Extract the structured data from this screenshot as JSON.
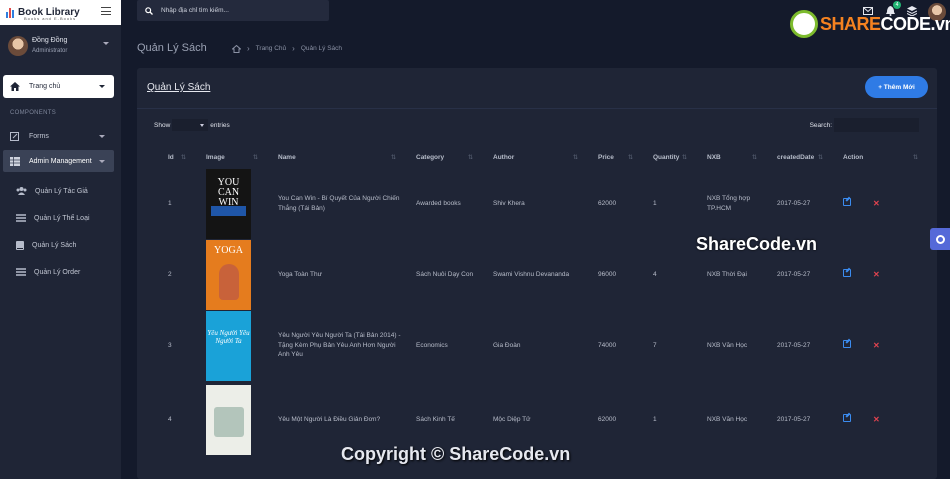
{
  "brand": {
    "title": "Book Library",
    "subtitle": "Books and E-Books"
  },
  "user": {
    "name": "Đồng Đồng",
    "role": "Administrator"
  },
  "sidebar": {
    "home_label": "Trang chủ",
    "section_label": "COMPONENTS",
    "forms_label": "Forms",
    "admin_label": "Admin Management",
    "sub_items": [
      {
        "label": "Quản Lý Tác Giả",
        "icon": "users-icon"
      },
      {
        "label": "Quản Lý Thể Loại",
        "icon": "list-icon"
      },
      {
        "label": "Quản Lý Sách",
        "icon": "book-icon"
      },
      {
        "label": "Quản Lý Order",
        "icon": "list-icon"
      }
    ]
  },
  "topbar": {
    "search_placeholder": "Nhập địa chỉ tìm kiếm...",
    "notification_count": "4",
    "watermark": {
      "share": "SHARE",
      "code": "CODE.vn"
    }
  },
  "page": {
    "title": "Quản Lý Sách",
    "breadcrumb": [
      "Trang Chủ",
      "Quản Lý Sách"
    ]
  },
  "card": {
    "title": "Quản Lý Sách",
    "add_button": "+ Thêm Mới",
    "show_label": "Show",
    "entries_label": "entries",
    "search_label": "Search:"
  },
  "table": {
    "columns": [
      "Id",
      "Image",
      "Name",
      "Category",
      "Author",
      "Price",
      "Quantity",
      "NXB",
      "createdDate",
      "Action"
    ],
    "rows": [
      {
        "id": "1",
        "cover_title": "YOU CAN WIN",
        "name": "You Can Win - Bí Quyết Của Người Chiến Thắng (Tái Bản)",
        "category": "Awarded books",
        "author": "Shiv Khera",
        "price": "62000",
        "quantity": "1",
        "nxb": "NXB Tổng hợp TP.HCM",
        "created": "2017-05-27"
      },
      {
        "id": "2",
        "cover_title": "YOGA",
        "name": "Yoga Toàn Thư",
        "category": "Sách Nuôi Dạy Con",
        "author": "Swami Vishnu Devananda",
        "price": "96000",
        "quantity": "4",
        "nxb": "NXB Thời Đại",
        "created": "2017-05-27"
      },
      {
        "id": "3",
        "cover_title": "Yêu Người Yêu Người Ta",
        "name": "Yêu Người Yêu Người Ta (Tái Bản 2014) - Tặng Kèm Phụ Bản Yêu Anh Hơn Người Anh Yêu",
        "category": "Economics",
        "author": "Gia Đoàn",
        "price": "74000",
        "quantity": "7",
        "nxb": "NXB Văn Học",
        "created": "2017-05-27"
      },
      {
        "id": "4",
        "cover_title": "",
        "name": "Yêu Một Người Là Điều Giản Đơn?",
        "category": "Sách Kinh Tế",
        "author": "Mộc Diệp Tử",
        "price": "62000",
        "quantity": "1",
        "nxb": "NXB Văn Học",
        "created": "2017-05-27"
      }
    ]
  },
  "watermarks": {
    "middle": "ShareCode.vn",
    "bottom": "Copyright © ShareCode.vn"
  }
}
